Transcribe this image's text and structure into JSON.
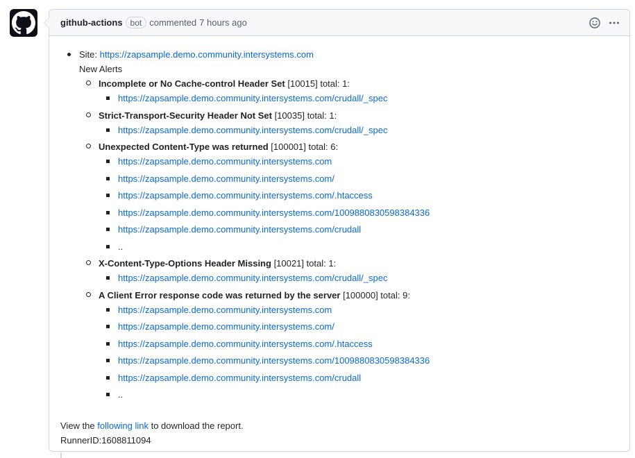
{
  "comment": {
    "author": "github-actions",
    "badge": "bot",
    "action": "commented",
    "timestamp": "7 hours ago",
    "icons": {
      "avatar": "github-mark-icon",
      "reaction": "smiley-icon",
      "menu": "kebab-horizontal-icon"
    }
  },
  "body": {
    "site_label": "Site:",
    "site_url": "https://zapsample.demo.community.intersystems.com",
    "new_alerts_label": "New Alerts",
    "alerts": [
      {
        "name": "Incomplete or No Cache-control Header Set",
        "suffix": "[10015] total: 1:",
        "urls": [
          "https://zapsample.demo.community.intersystems.com/crudall/_spec"
        ]
      },
      {
        "name": "Strict-Transport-Security Header Not Set",
        "suffix": "[10035] total: 1:",
        "urls": [
          "https://zapsample.demo.community.intersystems.com/crudall/_spec"
        ]
      },
      {
        "name": "Unexpected Content-Type was returned",
        "suffix": "[100001] total: 6:",
        "urls": [
          "https://zapsample.demo.community.intersystems.com",
          "https://zapsample.demo.community.intersystems.com/",
          "https://zapsample.demo.community.intersystems.com/.htaccess",
          "https://zapsample.demo.community.intersystems.com/1009880830598384336",
          "https://zapsample.demo.community.intersystems.com/crudall"
        ],
        "more": ".."
      },
      {
        "name": "X-Content-Type-Options Header Missing",
        "suffix": "[10021] total: 1:",
        "urls": [
          "https://zapsample.demo.community.intersystems.com/crudall/_spec"
        ]
      },
      {
        "name": "A Client Error response code was returned by the server",
        "suffix": "[100000] total: 9:",
        "urls": [
          "https://zapsample.demo.community.intersystems.com",
          "https://zapsample.demo.community.intersystems.com/",
          "https://zapsample.demo.community.intersystems.com/.htaccess",
          "https://zapsample.demo.community.intersystems.com/1009880830598384336",
          "https://zapsample.demo.community.intersystems.com/crudall"
        ],
        "more": ".."
      }
    ],
    "footer_prefix": "View the",
    "footer_link": "following link",
    "footer_suffix": "to download the report.",
    "runner_id": "RunnerID:1608811094"
  }
}
